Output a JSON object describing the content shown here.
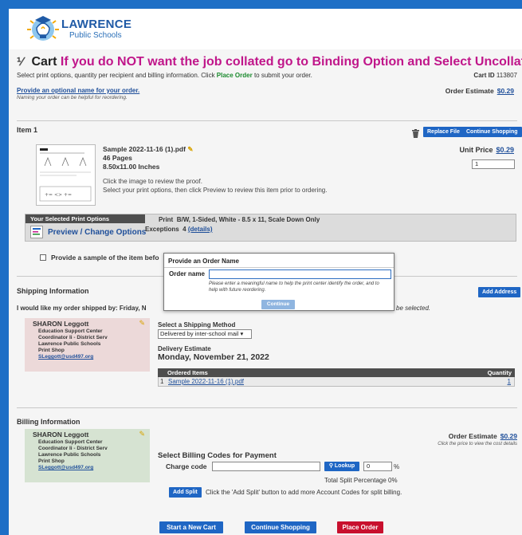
{
  "brand": {
    "name": "LAWRENCE",
    "sub": "Public Schools"
  },
  "cart": {
    "title": "Cart",
    "warning": "If you do NOT want the job collated go to Binding Option and Select Uncollated",
    "sub_before": "Select print options, quantity per recipient and billing information. Click ",
    "sub_bold": "Place Order",
    "sub_after": " to submit your order.",
    "cart_id_label": "Cart ID",
    "cart_id": "113807",
    "optional_name_link": "Provide an optional name for your order.",
    "optional_name_hint": "Naming your order can be helpful for reordering.",
    "order_estimate_label": "Order Estimate",
    "order_estimate": "$0.29"
  },
  "item": {
    "heading": "Item 1",
    "replace_file": "Replace File",
    "continue_shopping": "Continue Shopping",
    "filename": "Sample 2022-11-16 (1).pdf",
    "pages": "46 Pages",
    "size": "8.50x11.00 Inches",
    "proof_1": "Click the image to review the proof.",
    "proof_2": "Select your print options, then click Preview to review this item prior to ordering.",
    "unit_price_label": "Unit Price",
    "unit_price": "$0.29",
    "quantity": "1",
    "selected_options_tab": "Your Selected Print Options",
    "preview_change": "Preview / Change Options",
    "print_label": "Print",
    "print_value": "B/W, 1-Sided, White - 8.5 x 11, Scale Down Only",
    "exceptions_label": "Exceptions",
    "exceptions_count": "4",
    "exceptions_link": "(details)",
    "sample_text": "Provide a sample of the item befo"
  },
  "shipping": {
    "heading": "Shipping Information",
    "add_address": "Add Address",
    "shipped_by": "I would like my order shipped by:  Friday, N",
    "shipped_tail": "be selected.",
    "method_label": "Select a Shipping Method",
    "method_value": "Delivered by inter-school mail",
    "delivery_label": "Delivery Estimate",
    "delivery_date": "Monday, November 21, 2022",
    "ordered_items_h": "Ordered Items",
    "quantity_h": "Quantity",
    "ordered_row_num": "1",
    "ordered_row_file": "Sample 2022-11-16 (1).pdf",
    "ordered_row_qty": "1"
  },
  "contact": {
    "name": "SHARON Leggott",
    "line1": "Education Support Center",
    "line2": "Coordinator Ii - District Serv",
    "line3": "Lawrence Public Schools",
    "line4": "Print Shop",
    "email": "SLeggott@usd497.org"
  },
  "billing": {
    "heading": "Billing Information",
    "estimate_label": "Order Estimate",
    "estimate": "$0.29",
    "estimate_hint": "Click the price to view the cost details",
    "select_codes": "Select Billing Codes for Payment",
    "charge_label": "Charge code",
    "lookup": "Lookup",
    "percent_value": "0",
    "percent_sign": "%",
    "total_split": "Total Split Percentage  0%",
    "add_split": "Add Split",
    "add_split_note": "Click the 'Add Split' button to add more Account Codes for split billing."
  },
  "footer": {
    "new_cart": "Start a New Cart",
    "continue_shopping": "Continue Shopping",
    "place_order": "Place Order"
  },
  "modal": {
    "title": "Provide an Order Name",
    "label": "Order name",
    "note": "Please enter a meaningful name to help the print center identify the order, and to help with future reordering.",
    "button": "Continue"
  },
  "colors": {
    "accent_blue": "#1f66c4",
    "warning_magenta": "#c0168a",
    "place_order_red": "#c8102e",
    "shipping_card": "#ecd9d9",
    "billing_card": "#d6e3d2"
  }
}
